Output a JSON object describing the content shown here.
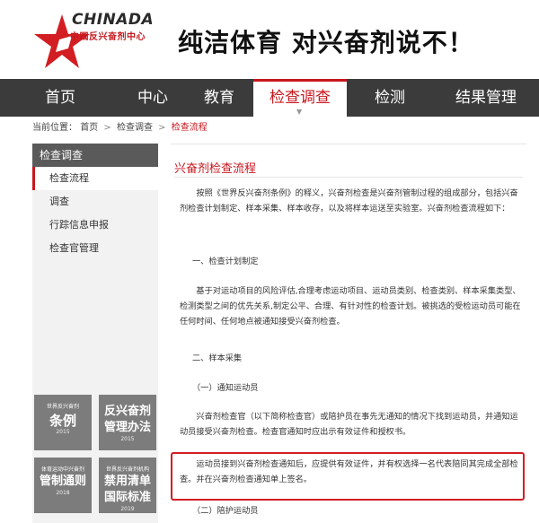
{
  "header": {
    "logo_en": "CHINADA",
    "logo_cn": "中国反兴奋剂中心",
    "slogan": "纯洁体育  对兴奋剂说不！"
  },
  "nav": {
    "items": [
      "首页",
      "中心",
      "教育",
      "检查调查",
      "检测",
      "结果管理"
    ],
    "active_index": 3
  },
  "breadcrumb": {
    "label": "当前位置：",
    "home": "首页",
    "parent": "检查调查",
    "current": "检查流程",
    "sep": ">"
  },
  "sidebar": {
    "heading": "检查调查",
    "items": [
      "检查流程",
      "调查",
      "行踪信息申报",
      "检查官管理"
    ],
    "active_index": 0,
    "tiles": [
      {
        "small": "世界反兴奋剂",
        "big": "条例",
        "year": "2015"
      },
      {
        "small": "",
        "big": "反兴奋剂管理办法",
        "year": "2015"
      },
      {
        "small": "体育运动中兴奋剂",
        "big": "管制通则",
        "year": "2018"
      },
      {
        "small": "世界反兴奋剂机构",
        "big": "禁用清单国际标准",
        "year": "2019"
      }
    ]
  },
  "content": {
    "title": "兴奋剂检查流程",
    "p1": "按照《世界反兴奋剂条例》的释义，兴奋剂检查是兴奋剂管制过程的组成部分，包括兴奋剂检查计划制定、样本采集、样本收存，以及将样本运送至实验室。兴奋剂检查流程如下：",
    "h1": "一、检查计划制定",
    "p2": "基于对运动项目的风险评估,合理考虑运动项目、运动员类别、检查类别、样本采集类型、检测类型之间的优先关系,制定公平、合理、有针对性的检查计划。被挑选的受检运动员可能在任何时间、任何地点被通知接受兴奋剂检查。",
    "h2": "二、样本采集",
    "h2a": "（一）通知运动员",
    "p3": "兴奋剂检查官（以下简称检查官）或陪护员在事先无通知的情况下找到运动员，并通知运动员接受兴奋剂检查。检查官通知时应出示有效证件和授权书。",
    "p4": "运动员接到兴奋剂检查通知后，应提供有效证件，并有权选择一名代表陪同其完成全部检查。并在兴奋剂检查通知单上签名。",
    "h2b": "（二）陪护运动员"
  },
  "colors": {
    "accent": "#c8161d",
    "nav_bg": "#3b3b3b",
    "tile_bg": "#7c7c7c"
  }
}
